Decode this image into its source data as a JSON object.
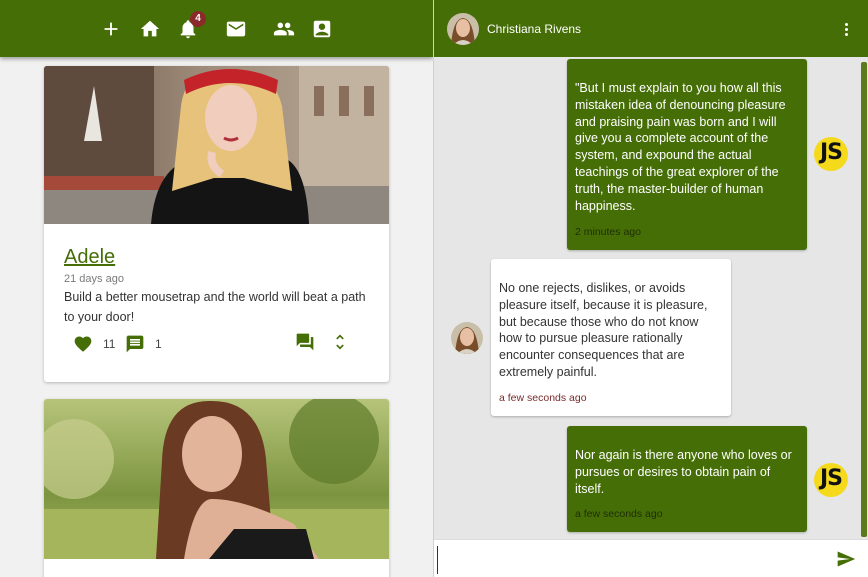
{
  "feed": {
    "nav": [
      {
        "name": "add",
        "icon": "plus-icon"
      },
      {
        "name": "home",
        "icon": "home-icon"
      },
      {
        "name": "notifications",
        "icon": "bell-icon",
        "badge": "4"
      },
      {
        "name": "messages",
        "icon": "mail-icon"
      },
      {
        "name": "people",
        "icon": "people-icon"
      },
      {
        "name": "profile",
        "icon": "contact-card-icon"
      }
    ],
    "posts": [
      {
        "author": "Adele",
        "time_ago": "21 days ago",
        "text": "Build a better mousetrap and the world will beat a path to your door!",
        "likes": "11",
        "comments": "1"
      },
      {
        "author": "",
        "time_ago": "",
        "text": ""
      }
    ]
  },
  "chat": {
    "contact_name": "Christiana Rivens",
    "messages": [
      {
        "direction": "sent",
        "avatar_initials": "JS",
        "text": "\"But I must explain to you how all this mistaken idea of denouncing pleasure and praising pain was born and I will give you a complete account of the system, and expound the actual teachings of the great explorer of the truth, the master-builder of human happiness.",
        "time": "2 minutes ago"
      },
      {
        "direction": "received",
        "text": "No one rejects, dislikes, or avoids pleasure itself, because it is pleasure, but because those who do not know how to pursue pleasure rationally encounter consequences that are extremely painful.",
        "time": "a few seconds ago"
      },
      {
        "direction": "sent",
        "avatar_initials": "JS",
        "text": "Nor again is there anyone who loves or pursues or desires to obtain pain of itself.",
        "time": "a few seconds ago"
      }
    ],
    "composer": {
      "placeholder": "",
      "value": ""
    }
  },
  "colors": {
    "brand": "#466e07",
    "badge": "#8a2a2a",
    "js_avatar": "#f5d91b"
  }
}
